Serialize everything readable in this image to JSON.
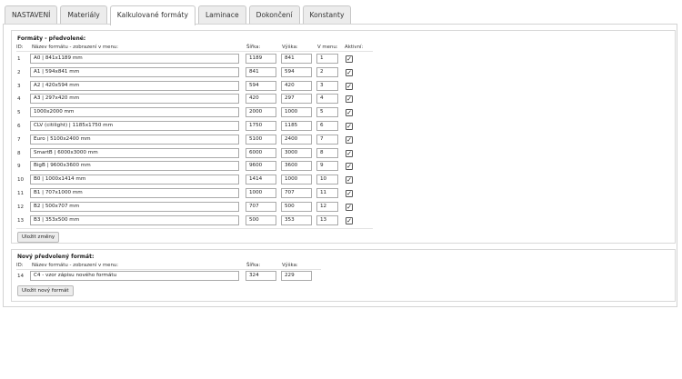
{
  "tabs": [
    {
      "label": "NASTAVENÍ",
      "active": false
    },
    {
      "label": "Materiály",
      "active": false
    },
    {
      "label": "Kalkulované formáty",
      "active": true
    },
    {
      "label": "Laminace",
      "active": false
    },
    {
      "label": "Dokončení",
      "active": false
    },
    {
      "label": "Konstanty",
      "active": false
    }
  ],
  "predefined": {
    "title": "Formáty - předvolené:",
    "headers": {
      "id": "ID:",
      "name": "Název formátu - zobrazení v menu:",
      "width": "Šířka:",
      "height": "Výška:",
      "menu": "V menu:",
      "active": "Aktivní:"
    },
    "rows": [
      {
        "id": "1",
        "name": "A0 | 841x1189 mm",
        "width": "1189",
        "height": "841",
        "menu": "1",
        "active": true
      },
      {
        "id": "2",
        "name": "A1 | 594x841 mm",
        "width": "841",
        "height": "594",
        "menu": "2",
        "active": true
      },
      {
        "id": "3",
        "name": "A2 | 420x594 mm",
        "width": "594",
        "height": "420",
        "menu": "3",
        "active": true
      },
      {
        "id": "4",
        "name": "A3 | 297x420 mm",
        "width": "420",
        "height": "297",
        "menu": "4",
        "active": true
      },
      {
        "id": "5",
        "name": "1000x2000 mm",
        "width": "2000",
        "height": "1000",
        "menu": "5",
        "active": true
      },
      {
        "id": "6",
        "name": "CLV (citilight) | 1185x1750 mm",
        "width": "1750",
        "height": "1185",
        "menu": "6",
        "active": true
      },
      {
        "id": "7",
        "name": "Euro | 5100x2400 mm",
        "width": "5100",
        "height": "2400",
        "menu": "7",
        "active": true
      },
      {
        "id": "8",
        "name": "SmartB | 6000x3000 mm",
        "width": "6000",
        "height": "3000",
        "menu": "8",
        "active": true
      },
      {
        "id": "9",
        "name": "BigB | 9600x3600 mm",
        "width": "9600",
        "height": "3600",
        "menu": "9",
        "active": true
      },
      {
        "id": "10",
        "name": "B0 | 1000x1414 mm",
        "width": "1414",
        "height": "1000",
        "menu": "10",
        "active": true
      },
      {
        "id": "11",
        "name": "B1 | 707x1000 mm",
        "width": "1000",
        "height": "707",
        "menu": "11",
        "active": true
      },
      {
        "id": "12",
        "name": "B2 | 500x707 mm",
        "width": "707",
        "height": "500",
        "menu": "12",
        "active": true
      },
      {
        "id": "13",
        "name": "B3 | 353x500 mm",
        "width": "500",
        "height": "353",
        "menu": "13",
        "active": true
      }
    ],
    "save_label": "Uložit změny"
  },
  "new_format": {
    "title": "Nový předvolený formát:",
    "headers": {
      "id": "ID:",
      "name": "Název formátu - zobrazení v menu:",
      "width": "Šířka:",
      "height": "Výška:"
    },
    "row": {
      "id": "14",
      "name": "C4 - vzor zápisu nového formátu",
      "width": "324",
      "height": "229"
    },
    "save_label": "Uložit nový formát"
  },
  "icons": {
    "checkbox_checked": "check-icon"
  }
}
